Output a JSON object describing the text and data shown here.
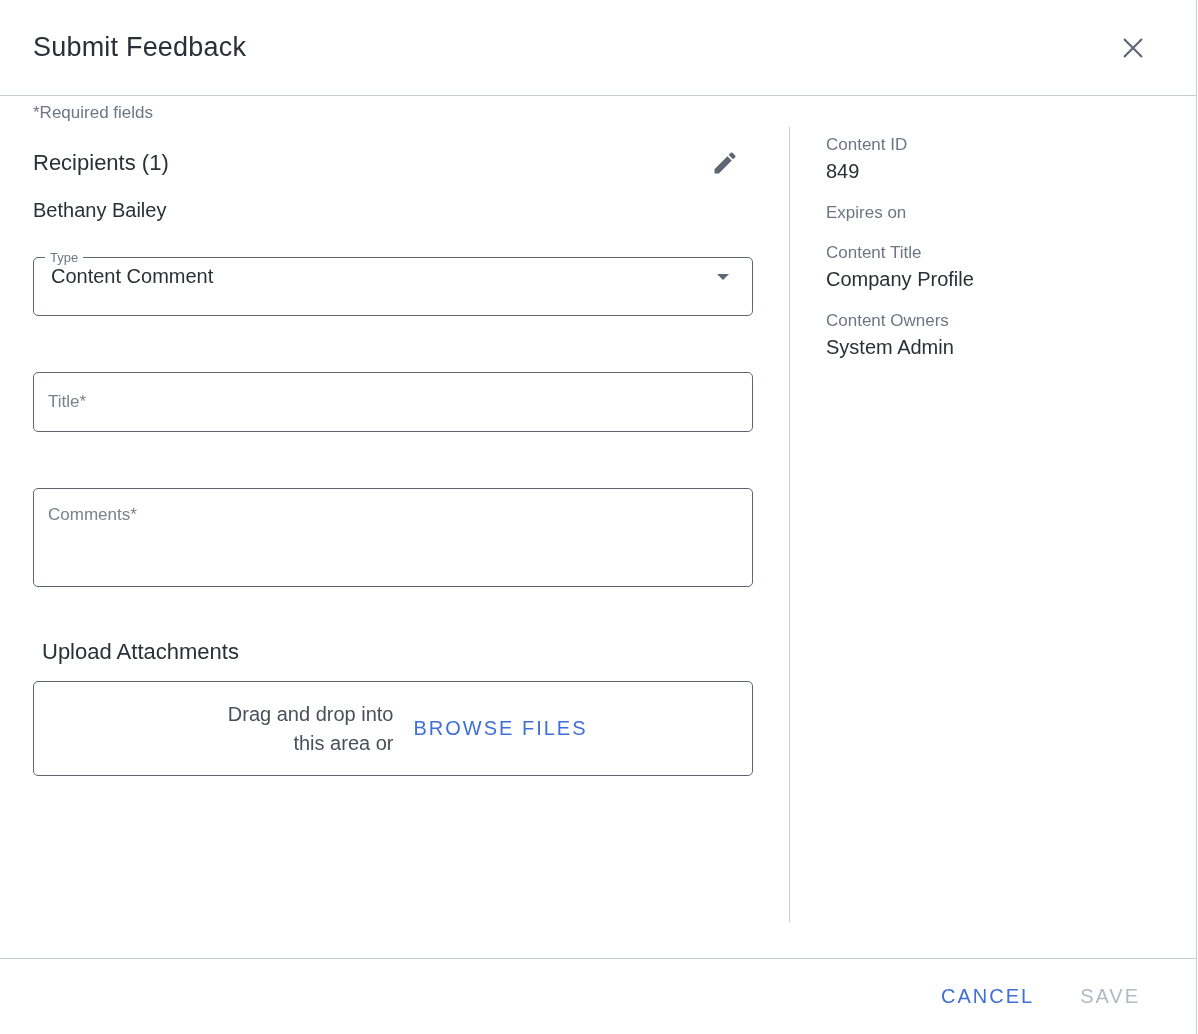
{
  "dialog": {
    "title": "Submit Feedback"
  },
  "required_note": "*Required fields",
  "recipients": {
    "heading": "Recipients (1)",
    "names": [
      "Bethany Bailey"
    ]
  },
  "type_field": {
    "label": "Type",
    "value": "Content Comment"
  },
  "title_field": {
    "placeholder": "Title*"
  },
  "comments_field": {
    "placeholder": "Comments*"
  },
  "upload": {
    "heading": "Upload Attachments",
    "hint": "Drag and drop into this area or",
    "browse": "BROWSE FILES"
  },
  "details": [
    {
      "label": "Content ID",
      "value": "849"
    },
    {
      "label": "Expires on"
    },
    {
      "label": "Content Title",
      "value": "Company Profile"
    },
    {
      "label": "Content Owners",
      "value": "System Admin"
    }
  ],
  "buttons": [
    {
      "label": "CANCEL",
      "disabled": false
    },
    {
      "label": "SAVE",
      "disabled": true
    }
  ]
}
